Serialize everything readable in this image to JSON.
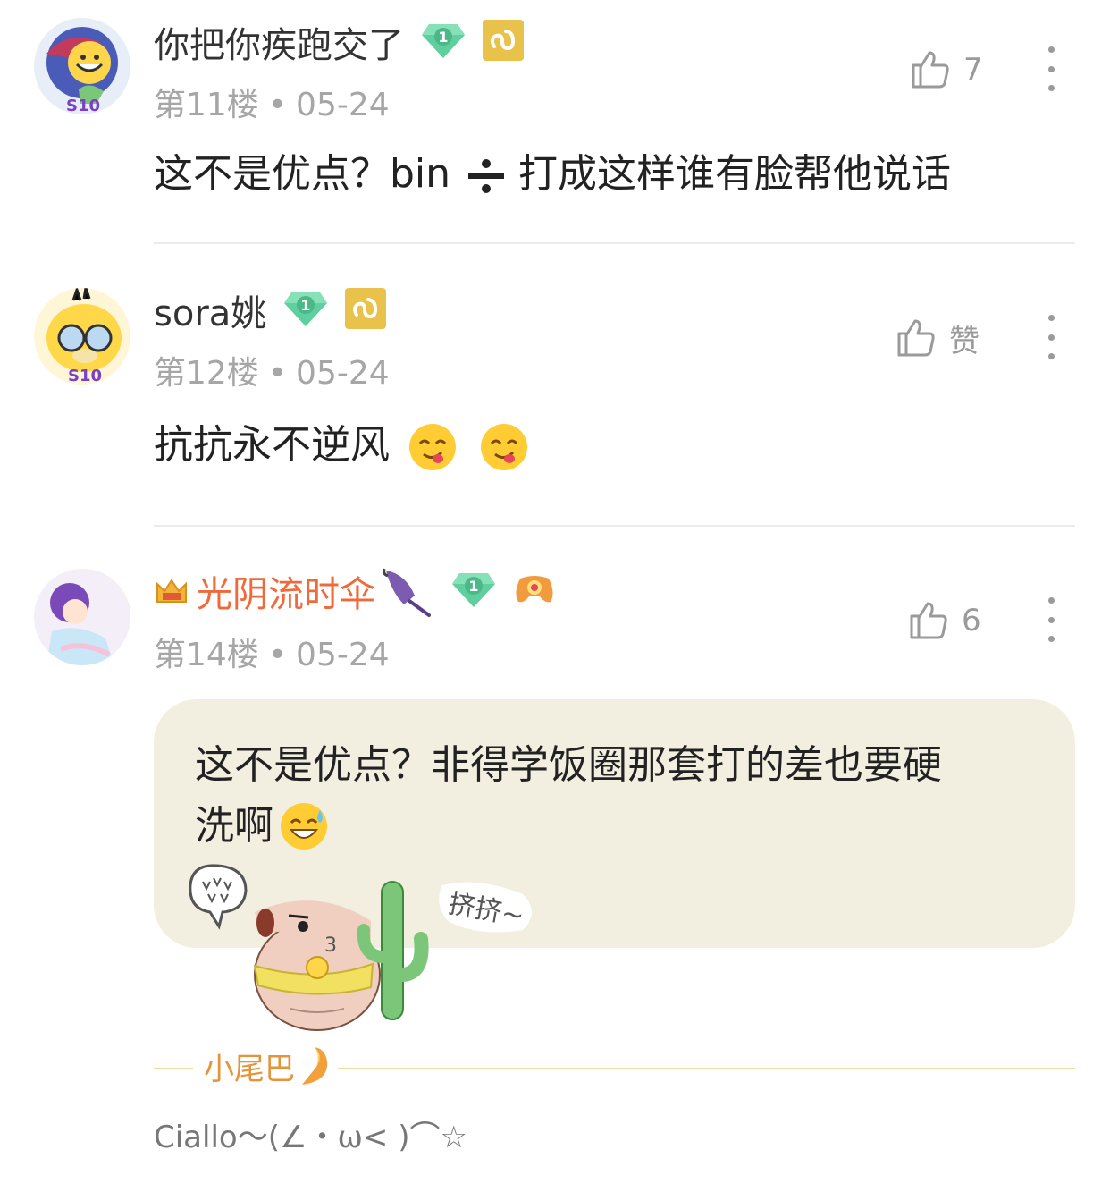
{
  "comments": [
    {
      "username": "你把你疾跑交了",
      "badge_level": "1",
      "floor": "第11楼",
      "date": "05-24",
      "likes": "7",
      "content_a": "这不是优点？bin",
      "content_b": "打成这样谁有脸帮他说话"
    },
    {
      "username": "sora姚",
      "badge_level": "1",
      "floor": "第12楼",
      "date": "05-24",
      "likes": "赞",
      "content": "抗抗永不逆风"
    },
    {
      "username": "光阴流时伞",
      "badge_level": "1",
      "floor": "第14楼",
      "date": "05-24",
      "likes": "6",
      "content_line1": "这不是优点？非得学饭圈那套打的差也要硬",
      "content_line2": "洗啊",
      "sticker_text": "挤挤~",
      "sticker_number": "3"
    }
  ],
  "separator_dot": "•",
  "avatar_badge_text": "S10",
  "tail": {
    "label": "小尾巴",
    "text": "Ciallo～(∠・ω< )⌒☆"
  },
  "colors": {
    "vip_name": "#ee6a3a",
    "quote_bg": "#f3efe0",
    "badge_green": "#5fcfa0",
    "badge_gold": "#e8c24a"
  }
}
